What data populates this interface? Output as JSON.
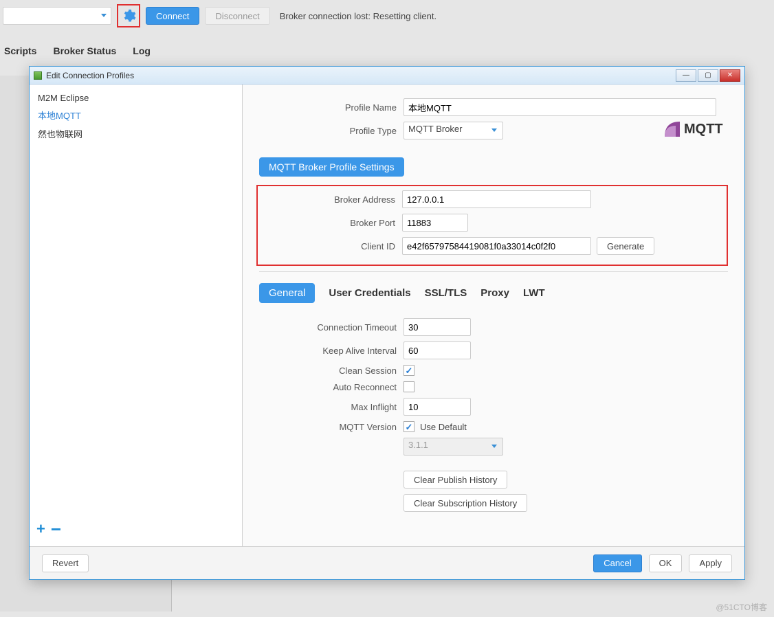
{
  "toolbar": {
    "connect_label": "Connect",
    "disconnect_label": "Disconnect",
    "status_text": "Broker connection lost: Resetting client."
  },
  "main_tabs": {
    "scripts": "Scripts",
    "broker_status": "Broker Status",
    "log": "Log"
  },
  "dialog": {
    "title": "Edit Connection Profiles",
    "profiles": [
      {
        "name": "M2M Eclipse",
        "selected": false
      },
      {
        "name": "本地MQTT",
        "selected": true
      },
      {
        "name": "然也物联网",
        "selected": false
      }
    ],
    "labels": {
      "profile_name": "Profile Name",
      "profile_type": "Profile Type",
      "broker_address": "Broker Address",
      "broker_port": "Broker Port",
      "client_id": "Client ID",
      "connection_timeout": "Connection Timeout",
      "keep_alive_interval": "Keep Alive Interval",
      "clean_session": "Clean Session",
      "auto_reconnect": "Auto Reconnect",
      "max_inflight": "Max Inflight",
      "mqtt_version": "MQTT Version",
      "use_default": "Use Default"
    },
    "values": {
      "profile_name": "本地MQTT",
      "profile_type": "MQTT Broker",
      "broker_address": "127.0.0.1",
      "broker_port": "11883",
      "client_id": "e42f65797584419081f0a33014c0f2f0",
      "connection_timeout": "30",
      "keep_alive_interval": "60",
      "clean_session": true,
      "auto_reconnect": false,
      "max_inflight": "10",
      "mqtt_version_use_default": true,
      "mqtt_version_value": "3.1.1"
    },
    "section_title": "MQTT Broker Profile Settings",
    "settings_tabs": {
      "general": "General",
      "user_credentials": "User Credentials",
      "ssl_tls": "SSL/TLS",
      "proxy": "Proxy",
      "lwt": "LWT"
    },
    "buttons": {
      "generate": "Generate",
      "clear_publish": "Clear Publish History",
      "clear_subscription": "Clear Subscription History",
      "revert": "Revert",
      "cancel": "Cancel",
      "ok": "OK",
      "apply": "Apply"
    },
    "logo_text": "MQTT"
  },
  "watermark": "@51CTO博客"
}
